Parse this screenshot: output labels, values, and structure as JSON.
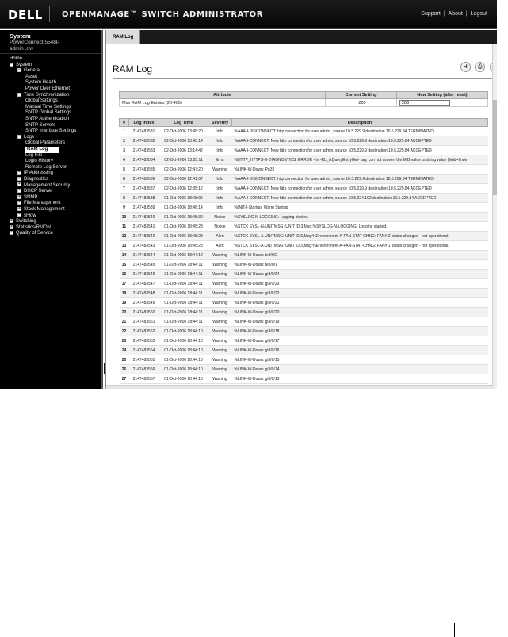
{
  "banner": {
    "logo": "DELL",
    "title": "OPENMANAGE™ SWITCH ADMINISTRATOR",
    "links": [
      "Support",
      "About",
      "Logout"
    ],
    "separator": "|"
  },
  "nav": {
    "system_label": "System",
    "model": "PowerConnect 5548P",
    "user": "admin ,r/w",
    "items": [
      {
        "label": "Home",
        "indent": 0,
        "box": ""
      },
      {
        "label": "System",
        "indent": 0,
        "box": "−"
      },
      {
        "label": "General",
        "indent": 1,
        "box": "−"
      },
      {
        "label": "Asset",
        "indent": 2,
        "box": ""
      },
      {
        "label": "System Health",
        "indent": 2,
        "box": ""
      },
      {
        "label": "Power Over Ethernet",
        "indent": 2,
        "box": ""
      },
      {
        "label": "Time Synchronization",
        "indent": 1,
        "box": "−"
      },
      {
        "label": "Global Settings",
        "indent": 2,
        "box": ""
      },
      {
        "label": "Manual Time Settings",
        "indent": 2,
        "box": ""
      },
      {
        "label": "SNTP Global Settings",
        "indent": 2,
        "box": ""
      },
      {
        "label": "SNTP Authentication",
        "indent": 2,
        "box": ""
      },
      {
        "label": "SNTP Servers",
        "indent": 2,
        "box": ""
      },
      {
        "label": "SNTP Interface Settings",
        "indent": 2,
        "box": ""
      },
      {
        "label": "Logs",
        "indent": 1,
        "box": "−"
      },
      {
        "label": "Global Parameters",
        "indent": 2,
        "box": ""
      },
      {
        "label": "RAM Log",
        "indent": 2,
        "box": "",
        "selected": true
      },
      {
        "label": "Log File",
        "indent": 2,
        "box": ""
      },
      {
        "label": "Login History",
        "indent": 2,
        "box": ""
      },
      {
        "label": "Remote Log Server",
        "indent": 2,
        "box": ""
      },
      {
        "label": "IP Addressing",
        "indent": 1,
        "box": "+"
      },
      {
        "label": "Diagnostics",
        "indent": 1,
        "box": "+"
      },
      {
        "label": "Management Security",
        "indent": 1,
        "box": "+"
      },
      {
        "label": "DHCP Server",
        "indent": 1,
        "box": "+"
      },
      {
        "label": "SNMP",
        "indent": 1,
        "box": "+"
      },
      {
        "label": "File Management",
        "indent": 1,
        "box": "+"
      },
      {
        "label": "Stack Management",
        "indent": 1,
        "box": "+"
      },
      {
        "label": "sFlow",
        "indent": 1,
        "box": "+"
      },
      {
        "label": "Switching",
        "indent": 0,
        "box": "+"
      },
      {
        "label": "Statistics/RMON",
        "indent": 0,
        "box": "+"
      },
      {
        "label": "Quality of Service",
        "indent": 0,
        "box": "+"
      }
    ]
  },
  "tab": {
    "label": "RAM Log"
  },
  "page": {
    "title": "RAM Log"
  },
  "toolbar": {
    "icons": [
      "save-icon",
      "print-icon",
      "refresh-icon"
    ],
    "glyphs": [
      "H",
      "⎙",
      "C"
    ]
  },
  "attributes": {
    "headers": [
      "Attribute",
      "Current Setting",
      "New Setting (after reset)"
    ],
    "row": {
      "name": "Max RAM Log Entries (20-400)",
      "current": "200",
      "new_value": "200"
    }
  },
  "log": {
    "headers": [
      "#",
      "Log Index",
      "Log Time",
      "Severity",
      "Description"
    ],
    "rows": [
      [
        "1",
        "2147483531",
        "02-Oct-2006 13:45:20",
        "Info",
        "%AAA-I-DISCONNECT: http connection for user admin, source 10.5.229.9 destination 10.5.229.84 TERMINATED"
      ],
      [
        "2",
        "2147483532",
        "02-Oct-2006 13:45:14",
        "Info",
        "%AAA-I-CONNECT: New http connection for user admin, source 10.5.229.9 destination 10.5.229.84 ACCEPTED"
      ],
      [
        "3",
        "2147483533",
        "02-Oct-2006 13:14:42",
        "Info",
        "%AAA-I-CONNECT: New http connection for user admin, source 10.5.229.9 destination 10.5.229.84 ACCEPTED"
      ],
      [
        "4",
        "2147483534",
        "02-Oct-2006 13:05:11",
        "Error",
        "%HTTP_HTTPS-E-DIAGNOSTICS: ERROR - in -RL_vtQueryEntryGet- tag, can not convert the MIB value to string value (field=finde"
      ],
      [
        "5",
        "2147483535",
        "02-Oct-2006 12:47:20",
        "Warning",
        "%LINK-W-Down:  Po32"
      ],
      [
        "6",
        "2147483536",
        "02-Oct-2006 12:41:07",
        "Info",
        "%AAA-I-DISCONNECT: http connection for user admin, source 10.5.229.9 destination 10.5.229.84 TERMINATED"
      ],
      [
        "7",
        "2147483537",
        "02-Oct-2006 12:35:12",
        "Info",
        "%AAA-I-CONNECT: New http connection for user admin, source 10.5.229.9 destination 10.5.229.84 ACCEPTED"
      ],
      [
        "8",
        "2147483538",
        "01-Oct-2006 18:48:05",
        "Info",
        "%AAA-I-CONNECT: New http connection for user admin, source 10.5.224.192 destination 10.5.229.84 ACCEPTED"
      ],
      [
        "9",
        "2147483539",
        "01-Oct-2006 18:46:14",
        "Info",
        "%INIT-I-Startup: Warm Startup"
      ],
      [
        "10",
        "2147483540",
        "01-Oct-2006 18:45:39",
        "Notice",
        "%SYSLOG-N-LOGGING: Logging started."
      ],
      [
        "11",
        "2147483541",
        "01-Oct-2006 18:45:28",
        "Notice",
        "%STCK SYSL-N-UNITMSG: UNIT ID 3,Msg:%SYSLOG-N-LOGGING: Logging started."
      ],
      [
        "12",
        "2147483542",
        "01-Oct-2006 18:45:28",
        "Alert",
        "%STCK SYSL-A-UNITMSG: UNIT ID 3,Msg:%Environment-A-FAN-STAT-CHNG: FAN# 2 status changed - not operational."
      ],
      [
        "13",
        "2147483543",
        "01-Oct-2006 18:45:28",
        "Alert",
        "%STCK SYSL-A-UNITMSG: UNIT ID 3,Msg:%Environment-A-FAN-STAT-CHNG: FAN# 1 status changed - not operational."
      ],
      [
        "14",
        "2147483544",
        "01-Oct-2006 18:44:12",
        "Warning",
        "%LINK-W-Down:  te3/0/2"
      ],
      [
        "15",
        "2147483545",
        "01-Oct-2006 18:44:11",
        "Warning",
        "%LINK-W-Down:  te3/0/1"
      ],
      [
        "16",
        "2147483546",
        "01-Oct-2006 18:44:11",
        "Warning",
        "%LINK-W-Down:  gi3/0/24"
      ],
      [
        "17",
        "2147483547",
        "01-Oct-2006 18:44:11",
        "Warning",
        "%LINK-W-Down:  gi3/0/23"
      ],
      [
        "18",
        "2147483548",
        "01-Oct-2006 18:44:11",
        "Warning",
        "%LINK-W-Down:  gi3/0/22"
      ],
      [
        "19",
        "2147483549",
        "01-Oct-2006 18:44:11",
        "Warning",
        "%LINK-W-Down:  gi3/0/21"
      ],
      [
        "20",
        "2147483550",
        "01-Oct-2006 18:44:11",
        "Warning",
        "%LINK-W-Down:  gi3/0/20"
      ],
      [
        "21",
        "2147483551",
        "01-Oct-2006 18:44:11",
        "Warning",
        "%LINK-W-Down:  gi3/0/19"
      ],
      [
        "22",
        "2147483552",
        "01-Oct-2006 18:44:10",
        "Warning",
        "%LINK-W-Down:  gi3/0/18"
      ],
      [
        "23",
        "2147483553",
        "01-Oct-2006 18:44:10",
        "Warning",
        "%LINK-W-Down:  gi3/0/17"
      ],
      [
        "24",
        "2147483554",
        "01-Oct-2006 18:44:10",
        "Warning",
        "%LINK-W-Down:  gi3/0/16"
      ],
      [
        "25",
        "2147483555",
        "01-Oct-2006 18:44:10",
        "Warning",
        "%LINK-W-Down:  gi3/0/15"
      ],
      [
        "26",
        "2147483556",
        "01-Oct-2006 18:44:10",
        "Warning",
        "%LINK-W-Down:  gi3/0/14"
      ],
      [
        "27",
        "2147483557",
        "01-Oct-2006 18:44:10",
        "Warning",
        "%LINK-W-Down:  gi3/0/13"
      ]
    ]
  }
}
